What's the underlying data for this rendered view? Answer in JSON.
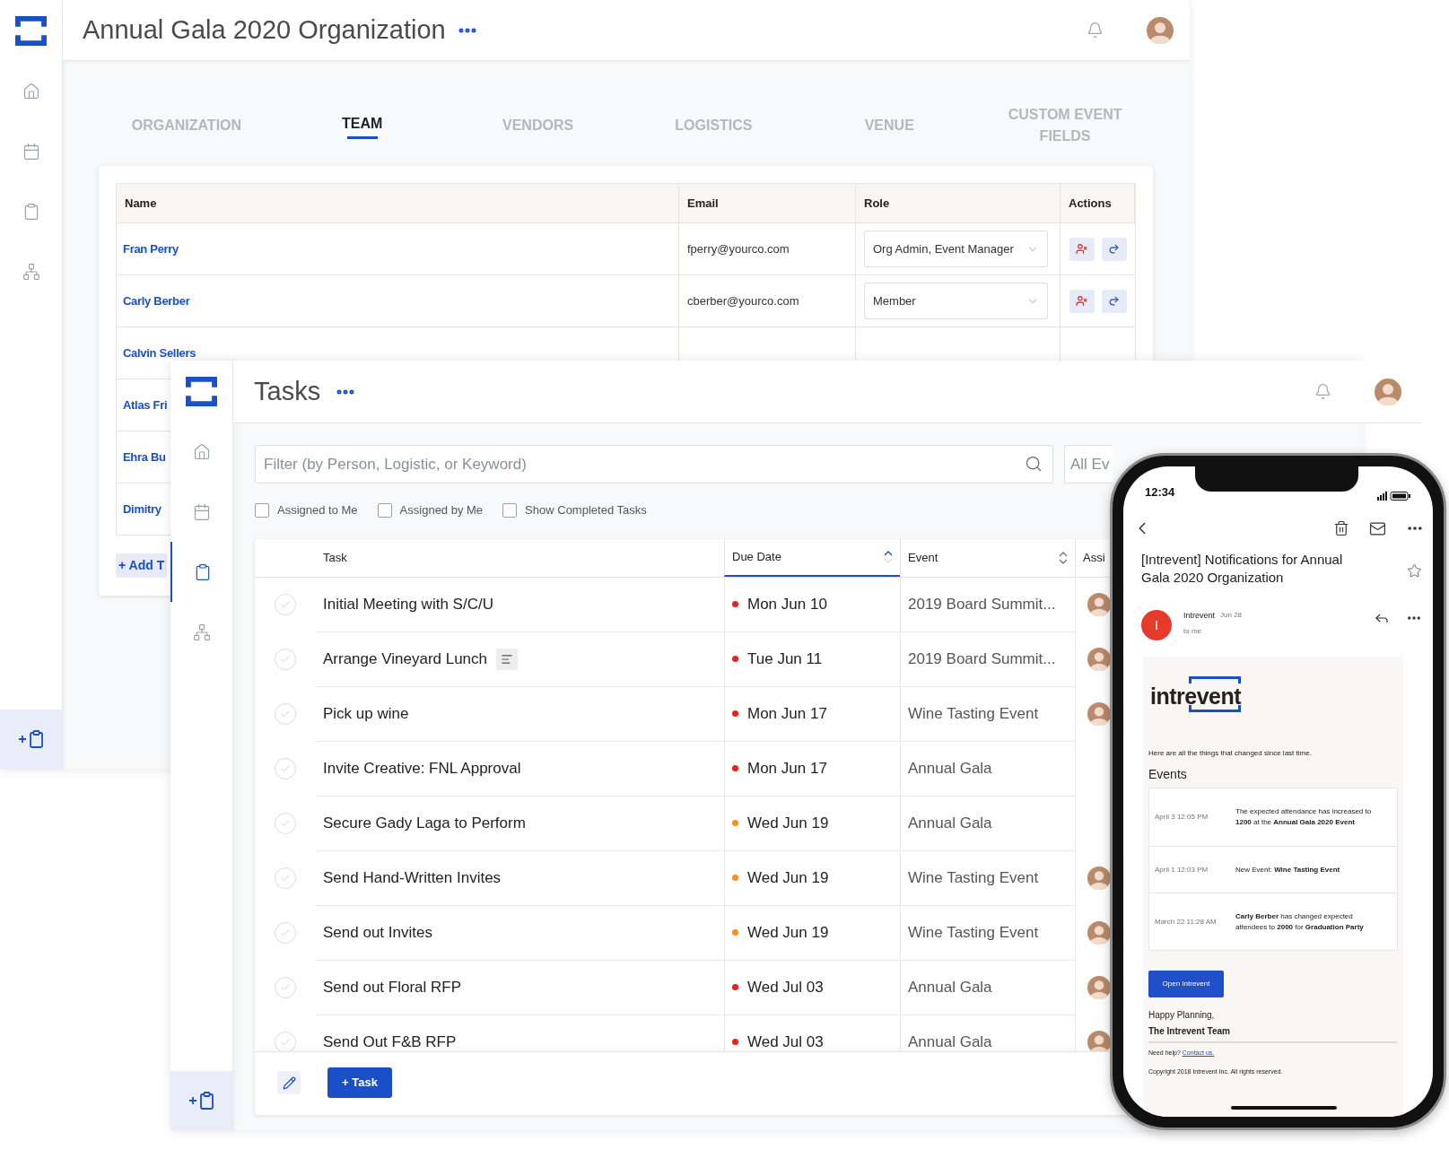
{
  "org_window": {
    "title": "Annual Gala 2020 Organization",
    "tabs": [
      {
        "label": "ORGANIZATION",
        "selected": false
      },
      {
        "label": "TEAM",
        "selected": true
      },
      {
        "label": "VENDORS",
        "selected": false
      },
      {
        "label": "LOGISTICS",
        "selected": false
      },
      {
        "label": "VENUE",
        "selected": false
      },
      {
        "label": "CUSTOM EVENT FIELDS",
        "selected": false
      }
    ],
    "team_table": {
      "columns": [
        "Name",
        "Email",
        "Role",
        "Actions"
      ],
      "rows": [
        {
          "name": "Fran Perry",
          "email": "fperry@yourco.com",
          "role": "Org Admin, Event Manager"
        },
        {
          "name": "Carly Berber",
          "email": "cberber@yourco.com",
          "role": "Member"
        },
        {
          "name": "Calvin Sellers"
        },
        {
          "name": "Atlas Fri"
        },
        {
          "name": "Ehra Bu"
        },
        {
          "name": "Dimitry"
        }
      ],
      "add_button": "+ Add T"
    }
  },
  "tasks_window": {
    "title": "Tasks",
    "filter": {
      "placeholder": "Filter (by Person, Logistic, or Keyword)"
    },
    "event_select": {
      "value": "All Ev"
    },
    "filters": [
      {
        "label": "Assigned to Me",
        "checked": false
      },
      {
        "label": "Assigned by Me",
        "checked": false
      },
      {
        "label": "Show Completed Tasks",
        "checked": false
      }
    ],
    "columns": [
      {
        "label": "Task",
        "sortable": false,
        "selected": false
      },
      {
        "label": "Due Date",
        "sortable": true,
        "selected": true
      },
      {
        "label": "Event",
        "sortable": true,
        "selected": false
      },
      {
        "label": "Assi",
        "sortable": false,
        "selected": false
      }
    ],
    "rows": [
      {
        "task": "Initial Meeting with S/C/U",
        "done": false,
        "has_note": false,
        "color": "#e8221b",
        "due": "Mon Jun 10",
        "event": "2019 Board Summit...",
        "assigned": true
      },
      {
        "task": "Arrange Vineyard Lunch",
        "done": false,
        "has_note": true,
        "color": "#e8221b",
        "due": "Tue Jun 11",
        "event": "2019 Board Summit...",
        "assigned": true
      },
      {
        "task": "Pick up wine",
        "done": false,
        "has_note": false,
        "color": "#e8221b",
        "due": "Mon Jun 17",
        "event": "Wine Tasting Event",
        "assigned": true
      },
      {
        "task": "Invite Creative: FNL Approval",
        "done": false,
        "has_note": false,
        "color": "#e8221b",
        "due": "Mon Jun 17",
        "event": "Annual Gala",
        "assigned": false
      },
      {
        "task": "Secure Gady Laga to Perform",
        "done": false,
        "has_note": false,
        "color": "#f5921e",
        "due": "Wed Jun 19",
        "event": "Annual Gala",
        "assigned": false
      },
      {
        "task": "Send Hand-Written Invites",
        "done": false,
        "has_note": false,
        "color": "#f5921e",
        "due": "Wed Jun 19",
        "event": "Wine Tasting Event",
        "assigned": true
      },
      {
        "task": "Send out Invites",
        "done": false,
        "has_note": false,
        "color": "#f5921e",
        "due": "Wed Jun 19",
        "event": "Wine Tasting Event",
        "assigned": true
      },
      {
        "task": "Send out Floral RFP",
        "done": false,
        "has_note": false,
        "color": "#e8221b",
        "due": "Wed Jul 03",
        "event": "Annual Gala",
        "assigned": true
      },
      {
        "task": "Send Out F&B RFP",
        "done": false,
        "has_note": false,
        "color": "#e8221b",
        "due": "Wed Jul 03",
        "event": "Annual Gala",
        "assigned": true
      }
    ],
    "add_button": "+ Task"
  },
  "phone": {
    "time": "12:34",
    "subject": "[Intrevent] Notifications for Annual Gala 2020 Organization",
    "sender": "Intrevent",
    "date": "Jun 28",
    "recipient": "to me",
    "sender_initial": "I",
    "logo": "intrevent",
    "intro": "Here are all the things that changed since last time.",
    "events_heading": "Events",
    "events": [
      {
        "time": "April 3 12:05 PM",
        "text": "The expected attendance has increased to **1200** at the **Annual Gala 2020 Event**"
      },
      {
        "time": "April 1 12:03 PM",
        "text": "New Event: **Wine Tasting Event**"
      },
      {
        "time": "March 22 11:28 AM",
        "text": "**Carly Berber** has changed expected attendees to **2000** for **Graduation Party**"
      }
    ],
    "button": "Open Intrevent",
    "signoff": "Happy Planning,",
    "team": "The Intrevent Team",
    "help": "Need help?",
    "help_link": "Contact us.",
    "copyright": "Copyright 2018 Intrevent Inc. All rights reserved."
  }
}
